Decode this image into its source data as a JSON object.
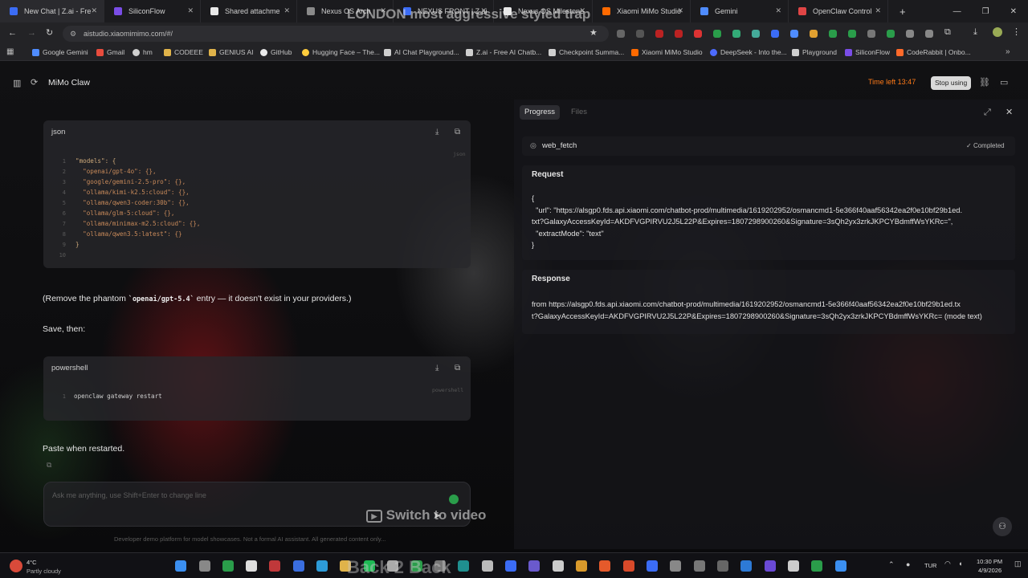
{
  "browser": {
    "tabs": [
      {
        "title": "New Chat | Z.ai - Fre",
        "color": "#3b6cf5"
      },
      {
        "title": "SiliconFlow",
        "color": "#7a4de6"
      },
      {
        "title": "Shared attachme",
        "color": "#e9e9e9"
      },
      {
        "title": "Nexus OS Arch",
        "color": "#8a8a8a"
      },
      {
        "title": "NEXUS FRONT | Z.ai",
        "color": "#3b6cf5"
      },
      {
        "title": "Nexus OS Milestone",
        "color": "#e9e9e9"
      },
      {
        "title": "Xiaomi MiMo Studio",
        "color": "#ff6a00"
      },
      {
        "title": "Gemini",
        "color": "#4f8cff"
      },
      {
        "title": "OpenClaw Control",
        "color": "#e04545"
      }
    ],
    "new_tab": "+",
    "url": "aistudio.xiaomimimo.com/#/",
    "overlay_title": "LONDON most aggressive styled trap",
    "bookmarks": [
      {
        "label": "Google Gemini",
        "color": "#4f8cff"
      },
      {
        "label": "Gmail",
        "color": "#e84c3d"
      },
      {
        "label": "hm",
        "color": "#cfcfcf"
      },
      {
        "label": "CODEEE",
        "color": "#e0b34a"
      },
      {
        "label": "GENIUS AI",
        "color": "#e0b34a"
      },
      {
        "label": "GitHub",
        "color": "#e9e9e9"
      },
      {
        "label": "Hugging Face – The...",
        "color": "#ffcc3d"
      },
      {
        "label": "AI Chat Playground...",
        "color": "#cfcfcf"
      },
      {
        "label": "Z.ai - Free AI Chatb...",
        "color": "#cfcfcf"
      },
      {
        "label": "Checkpoint Summa...",
        "color": "#cfcfcf"
      },
      {
        "label": "Xiaomi MiMo Studio",
        "color": "#ff6a00"
      },
      {
        "label": "DeepSeek - Into the...",
        "color": "#4d6bfe"
      },
      {
        "label": "Playground",
        "color": "#cfcfcf"
      },
      {
        "label": "SiliconFlow",
        "color": "#7a4de6"
      },
      {
        "label": "CodeRabbit | Onbo...",
        "color": "#ff6a2a"
      }
    ]
  },
  "app": {
    "title": "MiMo Claw",
    "time_left": "Time left 13:47",
    "stop_label": "Stop using",
    "accent": "#ff7a18"
  },
  "chat": {
    "code1": {
      "lang": "json",
      "lines": [
        "\"models\": {",
        "  \"openai/gpt-4o\": {},",
        "  \"google/gemini-2.5-pro\": {},",
        "  \"ollama/kimi-k2.5:cloud\": {},",
        "  \"ollama/qwen3-coder:30b\": {},",
        "  \"ollama/glm-5:cloud\": {},",
        "  \"ollama/minimax-m2.5:cloud\": {},",
        "  \"ollama/qwen3.5:latest\": {}",
        "}",
        ""
      ],
      "corner": "json"
    },
    "note_before": "(Remove the phantom",
    "note_code": "openai/gpt-5.4",
    "note_after": "entry — it doesn't exist in your providers.)",
    "save_then": "Save, then:",
    "code2": {
      "lang": "powershell",
      "lines": [
        "openclaw gateway restart"
      ],
      "corner": "powershell"
    },
    "paste": "Paste when restarted.",
    "input_placeholder": "Ask me anything, use Shift+Enter to change line",
    "disclaimer": "Developer demo platform for model showcases. Not a formal AI assistant. All generated content only..."
  },
  "panel": {
    "tabs": [
      "Progress",
      "Files"
    ],
    "tool": "web_fetch",
    "status": "Completed",
    "request_title": "Request",
    "request_lines": [
      "{",
      "  \"url\": \"https://alsgp0.fds.api.xiaomi.com/chatbot-prod/multimedia/1619202952/osmancmd1-5e366f40aaf56342ea2f0e10bf29b1ed.",
      "txt?GalaxyAccessKeyId=AKDFVGPIRVU2J5L22P&Expires=1807298900260&Signature=3sQh2yx3zrkJKPCYBdmffWsYKRc=\",",
      "  \"extractMode\": \"text\"",
      "}"
    ],
    "response_title": "Response",
    "response_lines": [
      "from https://alsgp0.fds.api.xiaomi.com/chatbot-prod/multimedia/1619202952/osmancmd1-5e366f40aaf56342ea2f0e10bf29b1ed.tx",
      "t?GalaxyAccessKeyId=AKDFVGPIRVU2J5L22P&Expires=1807298900260&Signature=3sQh2yx3zrkJKPCYBdmffWsYKRc= (mode text)"
    ]
  },
  "video_overlay": {
    "switch_label": "Switch to video",
    "back_label": "Back 2 Back"
  },
  "taskbar": {
    "weather_temp": "4°C",
    "weather_desc": "Partly cloudy",
    "lang": "TUR",
    "time": "10:30 PM",
    "date": "4/9/2026"
  }
}
